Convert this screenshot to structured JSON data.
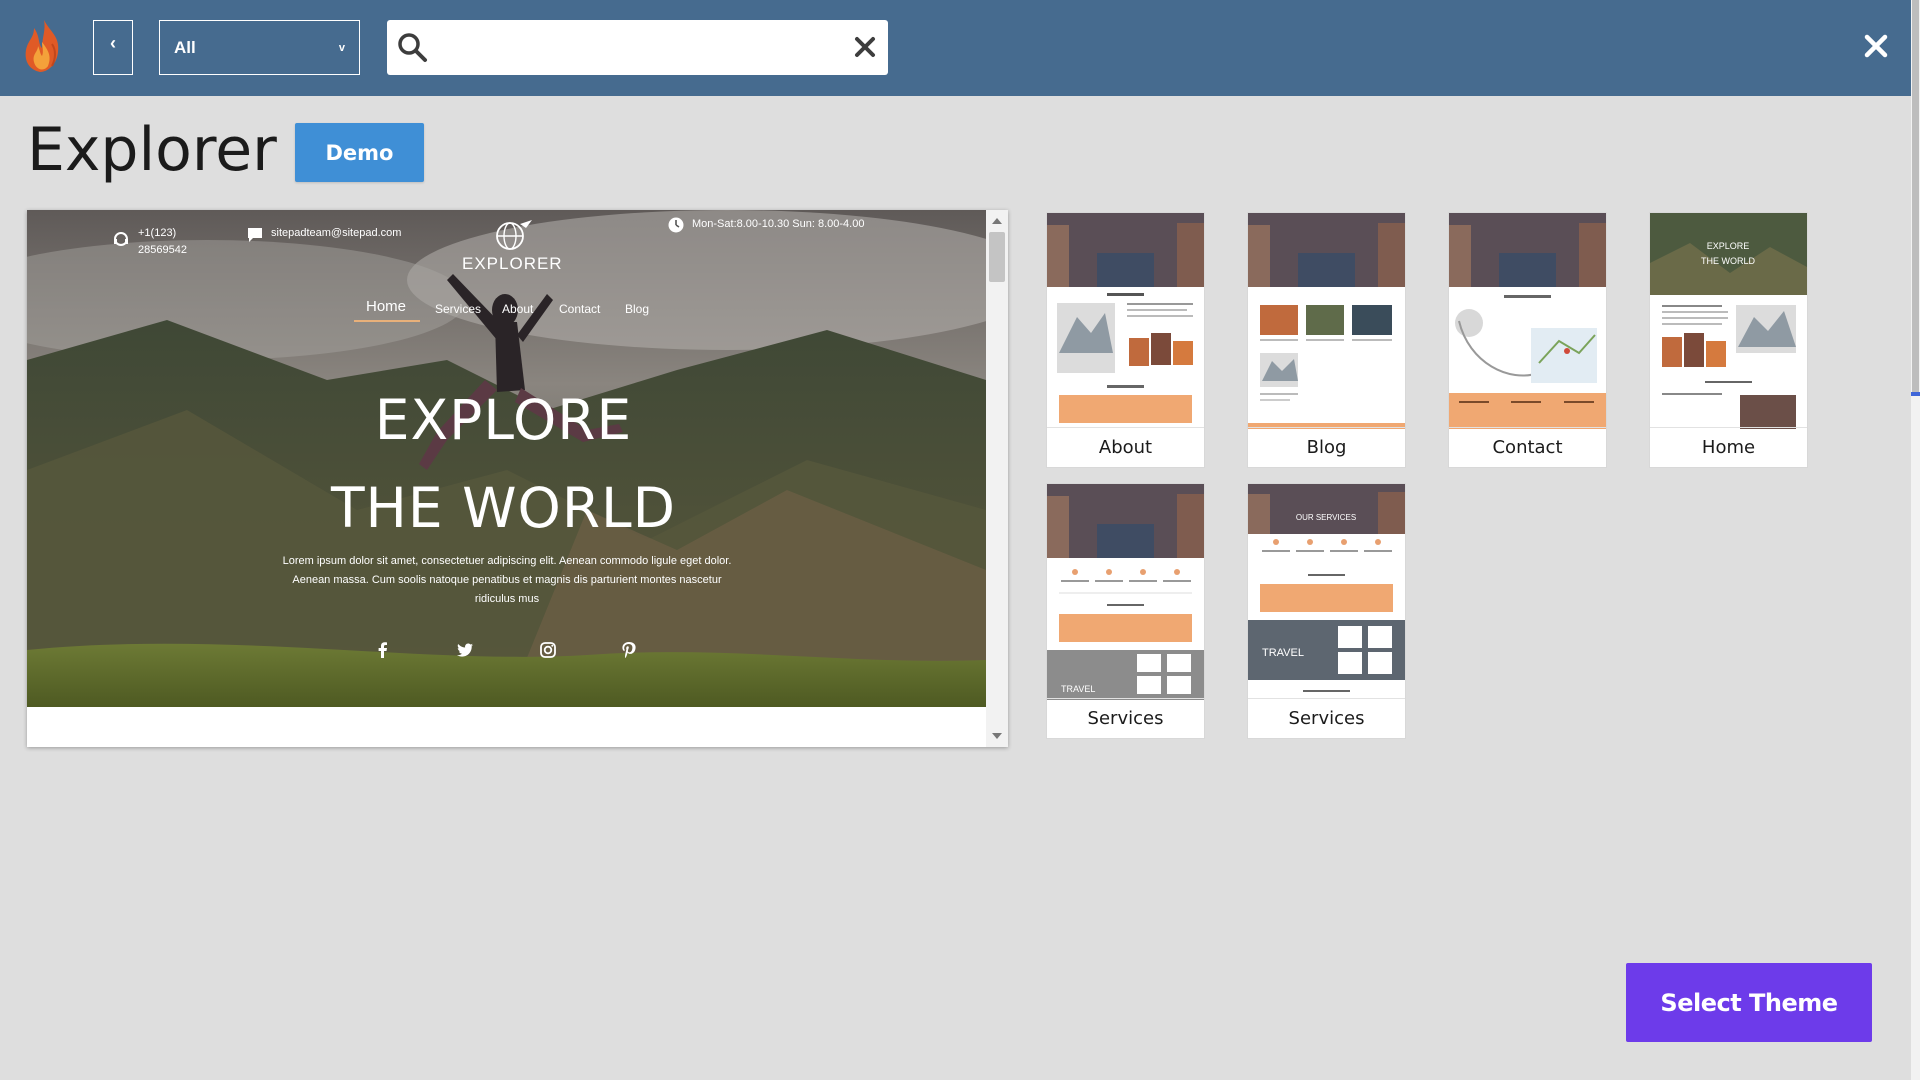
{
  "toolbar": {
    "back_label": "‹",
    "filter_value": "All",
    "search_placeholder": "",
    "search_value": ""
  },
  "page": {
    "title": "Explorer",
    "demo_label": "Demo",
    "select_label": "Select Theme"
  },
  "preview": {
    "phone": "+1(123)",
    "phone2": "28569542",
    "email": "sitepadteam@sitepad.com",
    "hours": "Mon-Sat:8.00-10.30 Sun: 8.00-4.00",
    "brand": "EXPLORER",
    "nav": [
      "Home",
      "Services",
      "About",
      "Contact",
      "Blog"
    ],
    "headline1": "EXPLORE",
    "headline2": "THE WORLD",
    "para_line1": "Lorem ipsum dolor sit amet, consectetuer adipiscing elit. Aenean commodo ligule eget dolor.",
    "para_line2": "Aenean massa. Cum soolis natoque penatibus et magnis dis parturient montes nascetur",
    "para_line3": "ridiculus mus"
  },
  "thumbnails": [
    {
      "label": "About"
    },
    {
      "label": "Blog"
    },
    {
      "label": "Contact"
    },
    {
      "label": "Home"
    },
    {
      "label": "Services"
    },
    {
      "label": "Services"
    }
  ],
  "colors": {
    "topbar": "#466b8f",
    "demo": "#3f8fd6",
    "select": "#6d3bea",
    "accent_orange": "#f0a872"
  }
}
